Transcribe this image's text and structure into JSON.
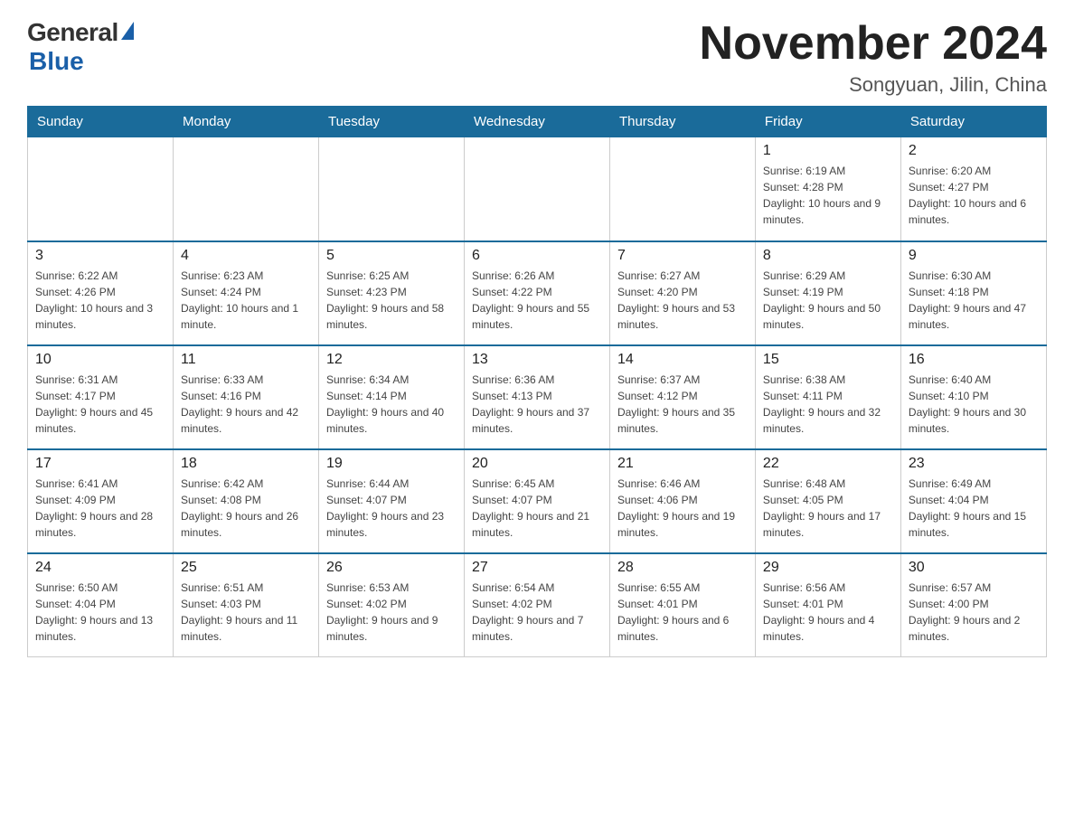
{
  "header": {
    "logo_general": "General",
    "logo_blue": "Blue",
    "main_title": "November 2024",
    "subtitle": "Songyuan, Jilin, China"
  },
  "days_of_week": [
    "Sunday",
    "Monday",
    "Tuesday",
    "Wednesday",
    "Thursday",
    "Friday",
    "Saturday"
  ],
  "weeks": [
    [
      {
        "day": "",
        "sunrise": "",
        "sunset": "",
        "daylight": ""
      },
      {
        "day": "",
        "sunrise": "",
        "sunset": "",
        "daylight": ""
      },
      {
        "day": "",
        "sunrise": "",
        "sunset": "",
        "daylight": ""
      },
      {
        "day": "",
        "sunrise": "",
        "sunset": "",
        "daylight": ""
      },
      {
        "day": "",
        "sunrise": "",
        "sunset": "",
        "daylight": ""
      },
      {
        "day": "1",
        "sunrise": "Sunrise: 6:19 AM",
        "sunset": "Sunset: 4:28 PM",
        "daylight": "Daylight: 10 hours and 9 minutes."
      },
      {
        "day": "2",
        "sunrise": "Sunrise: 6:20 AM",
        "sunset": "Sunset: 4:27 PM",
        "daylight": "Daylight: 10 hours and 6 minutes."
      }
    ],
    [
      {
        "day": "3",
        "sunrise": "Sunrise: 6:22 AM",
        "sunset": "Sunset: 4:26 PM",
        "daylight": "Daylight: 10 hours and 3 minutes."
      },
      {
        "day": "4",
        "sunrise": "Sunrise: 6:23 AM",
        "sunset": "Sunset: 4:24 PM",
        "daylight": "Daylight: 10 hours and 1 minute."
      },
      {
        "day": "5",
        "sunrise": "Sunrise: 6:25 AM",
        "sunset": "Sunset: 4:23 PM",
        "daylight": "Daylight: 9 hours and 58 minutes."
      },
      {
        "day": "6",
        "sunrise": "Sunrise: 6:26 AM",
        "sunset": "Sunset: 4:22 PM",
        "daylight": "Daylight: 9 hours and 55 minutes."
      },
      {
        "day": "7",
        "sunrise": "Sunrise: 6:27 AM",
        "sunset": "Sunset: 4:20 PM",
        "daylight": "Daylight: 9 hours and 53 minutes."
      },
      {
        "day": "8",
        "sunrise": "Sunrise: 6:29 AM",
        "sunset": "Sunset: 4:19 PM",
        "daylight": "Daylight: 9 hours and 50 minutes."
      },
      {
        "day": "9",
        "sunrise": "Sunrise: 6:30 AM",
        "sunset": "Sunset: 4:18 PM",
        "daylight": "Daylight: 9 hours and 47 minutes."
      }
    ],
    [
      {
        "day": "10",
        "sunrise": "Sunrise: 6:31 AM",
        "sunset": "Sunset: 4:17 PM",
        "daylight": "Daylight: 9 hours and 45 minutes."
      },
      {
        "day": "11",
        "sunrise": "Sunrise: 6:33 AM",
        "sunset": "Sunset: 4:16 PM",
        "daylight": "Daylight: 9 hours and 42 minutes."
      },
      {
        "day": "12",
        "sunrise": "Sunrise: 6:34 AM",
        "sunset": "Sunset: 4:14 PM",
        "daylight": "Daylight: 9 hours and 40 minutes."
      },
      {
        "day": "13",
        "sunrise": "Sunrise: 6:36 AM",
        "sunset": "Sunset: 4:13 PM",
        "daylight": "Daylight: 9 hours and 37 minutes."
      },
      {
        "day": "14",
        "sunrise": "Sunrise: 6:37 AM",
        "sunset": "Sunset: 4:12 PM",
        "daylight": "Daylight: 9 hours and 35 minutes."
      },
      {
        "day": "15",
        "sunrise": "Sunrise: 6:38 AM",
        "sunset": "Sunset: 4:11 PM",
        "daylight": "Daylight: 9 hours and 32 minutes."
      },
      {
        "day": "16",
        "sunrise": "Sunrise: 6:40 AM",
        "sunset": "Sunset: 4:10 PM",
        "daylight": "Daylight: 9 hours and 30 minutes."
      }
    ],
    [
      {
        "day": "17",
        "sunrise": "Sunrise: 6:41 AM",
        "sunset": "Sunset: 4:09 PM",
        "daylight": "Daylight: 9 hours and 28 minutes."
      },
      {
        "day": "18",
        "sunrise": "Sunrise: 6:42 AM",
        "sunset": "Sunset: 4:08 PM",
        "daylight": "Daylight: 9 hours and 26 minutes."
      },
      {
        "day": "19",
        "sunrise": "Sunrise: 6:44 AM",
        "sunset": "Sunset: 4:07 PM",
        "daylight": "Daylight: 9 hours and 23 minutes."
      },
      {
        "day": "20",
        "sunrise": "Sunrise: 6:45 AM",
        "sunset": "Sunset: 4:07 PM",
        "daylight": "Daylight: 9 hours and 21 minutes."
      },
      {
        "day": "21",
        "sunrise": "Sunrise: 6:46 AM",
        "sunset": "Sunset: 4:06 PM",
        "daylight": "Daylight: 9 hours and 19 minutes."
      },
      {
        "day": "22",
        "sunrise": "Sunrise: 6:48 AM",
        "sunset": "Sunset: 4:05 PM",
        "daylight": "Daylight: 9 hours and 17 minutes."
      },
      {
        "day": "23",
        "sunrise": "Sunrise: 6:49 AM",
        "sunset": "Sunset: 4:04 PM",
        "daylight": "Daylight: 9 hours and 15 minutes."
      }
    ],
    [
      {
        "day": "24",
        "sunrise": "Sunrise: 6:50 AM",
        "sunset": "Sunset: 4:04 PM",
        "daylight": "Daylight: 9 hours and 13 minutes."
      },
      {
        "day": "25",
        "sunrise": "Sunrise: 6:51 AM",
        "sunset": "Sunset: 4:03 PM",
        "daylight": "Daylight: 9 hours and 11 minutes."
      },
      {
        "day": "26",
        "sunrise": "Sunrise: 6:53 AM",
        "sunset": "Sunset: 4:02 PM",
        "daylight": "Daylight: 9 hours and 9 minutes."
      },
      {
        "day": "27",
        "sunrise": "Sunrise: 6:54 AM",
        "sunset": "Sunset: 4:02 PM",
        "daylight": "Daylight: 9 hours and 7 minutes."
      },
      {
        "day": "28",
        "sunrise": "Sunrise: 6:55 AM",
        "sunset": "Sunset: 4:01 PM",
        "daylight": "Daylight: 9 hours and 6 minutes."
      },
      {
        "day": "29",
        "sunrise": "Sunrise: 6:56 AM",
        "sunset": "Sunset: 4:01 PM",
        "daylight": "Daylight: 9 hours and 4 minutes."
      },
      {
        "day": "30",
        "sunrise": "Sunrise: 6:57 AM",
        "sunset": "Sunset: 4:00 PM",
        "daylight": "Daylight: 9 hours and 2 minutes."
      }
    ]
  ]
}
